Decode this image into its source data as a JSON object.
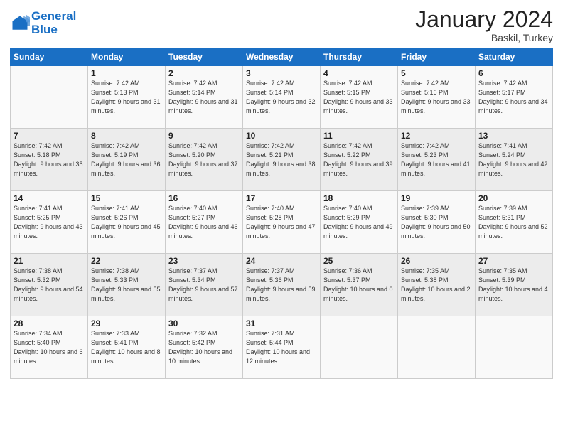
{
  "header": {
    "logo_line1": "General",
    "logo_line2": "Blue",
    "month_title": "January 2024",
    "location": "Baskil, Turkey"
  },
  "days_of_week": [
    "Sunday",
    "Monday",
    "Tuesday",
    "Wednesday",
    "Thursday",
    "Friday",
    "Saturday"
  ],
  "weeks": [
    [
      {
        "day": "",
        "sunrise": "",
        "sunset": "",
        "daylight": ""
      },
      {
        "day": "1",
        "sunrise": "Sunrise: 7:42 AM",
        "sunset": "Sunset: 5:13 PM",
        "daylight": "Daylight: 9 hours and 31 minutes."
      },
      {
        "day": "2",
        "sunrise": "Sunrise: 7:42 AM",
        "sunset": "Sunset: 5:14 PM",
        "daylight": "Daylight: 9 hours and 31 minutes."
      },
      {
        "day": "3",
        "sunrise": "Sunrise: 7:42 AM",
        "sunset": "Sunset: 5:14 PM",
        "daylight": "Daylight: 9 hours and 32 minutes."
      },
      {
        "day": "4",
        "sunrise": "Sunrise: 7:42 AM",
        "sunset": "Sunset: 5:15 PM",
        "daylight": "Daylight: 9 hours and 33 minutes."
      },
      {
        "day": "5",
        "sunrise": "Sunrise: 7:42 AM",
        "sunset": "Sunset: 5:16 PM",
        "daylight": "Daylight: 9 hours and 33 minutes."
      },
      {
        "day": "6",
        "sunrise": "Sunrise: 7:42 AM",
        "sunset": "Sunset: 5:17 PM",
        "daylight": "Daylight: 9 hours and 34 minutes."
      }
    ],
    [
      {
        "day": "7",
        "sunrise": "Sunrise: 7:42 AM",
        "sunset": "Sunset: 5:18 PM",
        "daylight": "Daylight: 9 hours and 35 minutes."
      },
      {
        "day": "8",
        "sunrise": "Sunrise: 7:42 AM",
        "sunset": "Sunset: 5:19 PM",
        "daylight": "Daylight: 9 hours and 36 minutes."
      },
      {
        "day": "9",
        "sunrise": "Sunrise: 7:42 AM",
        "sunset": "Sunset: 5:20 PM",
        "daylight": "Daylight: 9 hours and 37 minutes."
      },
      {
        "day": "10",
        "sunrise": "Sunrise: 7:42 AM",
        "sunset": "Sunset: 5:21 PM",
        "daylight": "Daylight: 9 hours and 38 minutes."
      },
      {
        "day": "11",
        "sunrise": "Sunrise: 7:42 AM",
        "sunset": "Sunset: 5:22 PM",
        "daylight": "Daylight: 9 hours and 39 minutes."
      },
      {
        "day": "12",
        "sunrise": "Sunrise: 7:42 AM",
        "sunset": "Sunset: 5:23 PM",
        "daylight": "Daylight: 9 hours and 41 minutes."
      },
      {
        "day": "13",
        "sunrise": "Sunrise: 7:41 AM",
        "sunset": "Sunset: 5:24 PM",
        "daylight": "Daylight: 9 hours and 42 minutes."
      }
    ],
    [
      {
        "day": "14",
        "sunrise": "Sunrise: 7:41 AM",
        "sunset": "Sunset: 5:25 PM",
        "daylight": "Daylight: 9 hours and 43 minutes."
      },
      {
        "day": "15",
        "sunrise": "Sunrise: 7:41 AM",
        "sunset": "Sunset: 5:26 PM",
        "daylight": "Daylight: 9 hours and 45 minutes."
      },
      {
        "day": "16",
        "sunrise": "Sunrise: 7:40 AM",
        "sunset": "Sunset: 5:27 PM",
        "daylight": "Daylight: 9 hours and 46 minutes."
      },
      {
        "day": "17",
        "sunrise": "Sunrise: 7:40 AM",
        "sunset": "Sunset: 5:28 PM",
        "daylight": "Daylight: 9 hours and 47 minutes."
      },
      {
        "day": "18",
        "sunrise": "Sunrise: 7:40 AM",
        "sunset": "Sunset: 5:29 PM",
        "daylight": "Daylight: 9 hours and 49 minutes."
      },
      {
        "day": "19",
        "sunrise": "Sunrise: 7:39 AM",
        "sunset": "Sunset: 5:30 PM",
        "daylight": "Daylight: 9 hours and 50 minutes."
      },
      {
        "day": "20",
        "sunrise": "Sunrise: 7:39 AM",
        "sunset": "Sunset: 5:31 PM",
        "daylight": "Daylight: 9 hours and 52 minutes."
      }
    ],
    [
      {
        "day": "21",
        "sunrise": "Sunrise: 7:38 AM",
        "sunset": "Sunset: 5:32 PM",
        "daylight": "Daylight: 9 hours and 54 minutes."
      },
      {
        "day": "22",
        "sunrise": "Sunrise: 7:38 AM",
        "sunset": "Sunset: 5:33 PM",
        "daylight": "Daylight: 9 hours and 55 minutes."
      },
      {
        "day": "23",
        "sunrise": "Sunrise: 7:37 AM",
        "sunset": "Sunset: 5:34 PM",
        "daylight": "Daylight: 9 hours and 57 minutes."
      },
      {
        "day": "24",
        "sunrise": "Sunrise: 7:37 AM",
        "sunset": "Sunset: 5:36 PM",
        "daylight": "Daylight: 9 hours and 59 minutes."
      },
      {
        "day": "25",
        "sunrise": "Sunrise: 7:36 AM",
        "sunset": "Sunset: 5:37 PM",
        "daylight": "Daylight: 10 hours and 0 minutes."
      },
      {
        "day": "26",
        "sunrise": "Sunrise: 7:35 AM",
        "sunset": "Sunset: 5:38 PM",
        "daylight": "Daylight: 10 hours and 2 minutes."
      },
      {
        "day": "27",
        "sunrise": "Sunrise: 7:35 AM",
        "sunset": "Sunset: 5:39 PM",
        "daylight": "Daylight: 10 hours and 4 minutes."
      }
    ],
    [
      {
        "day": "28",
        "sunrise": "Sunrise: 7:34 AM",
        "sunset": "Sunset: 5:40 PM",
        "daylight": "Daylight: 10 hours and 6 minutes."
      },
      {
        "day": "29",
        "sunrise": "Sunrise: 7:33 AM",
        "sunset": "Sunset: 5:41 PM",
        "daylight": "Daylight: 10 hours and 8 minutes."
      },
      {
        "day": "30",
        "sunrise": "Sunrise: 7:32 AM",
        "sunset": "Sunset: 5:42 PM",
        "daylight": "Daylight: 10 hours and 10 minutes."
      },
      {
        "day": "31",
        "sunrise": "Sunrise: 7:31 AM",
        "sunset": "Sunset: 5:44 PM",
        "daylight": "Daylight: 10 hours and 12 minutes."
      },
      {
        "day": "",
        "sunrise": "",
        "sunset": "",
        "daylight": ""
      },
      {
        "day": "",
        "sunrise": "",
        "sunset": "",
        "daylight": ""
      },
      {
        "day": "",
        "sunrise": "",
        "sunset": "",
        "daylight": ""
      }
    ]
  ]
}
